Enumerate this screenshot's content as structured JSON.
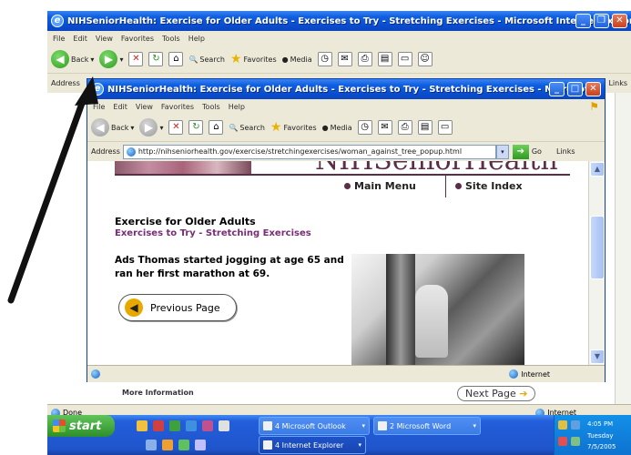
{
  "back_window": {
    "title": "NIHSeniorHealth: Exercise for Older Adults - Exercises to Try - Stretching Exercises - Microsoft Internet Explorer",
    "menu": [
      "File",
      "Edit",
      "View",
      "Favorites",
      "Tools",
      "Help"
    ],
    "toolbar": {
      "back": "Back",
      "search": "Search",
      "favorites": "Favorites",
      "media": "Media"
    },
    "address_label": "Address",
    "links_label": "Links",
    "status_left": "Done",
    "status_right": "Internet",
    "more_info": "More Information",
    "next_page": "Next Page"
  },
  "front_window": {
    "title": "NIHSeniorHealth: Exercise for Older Adults - Exercises to Try - Stretching Exercises - Microsof...",
    "menu": [
      "File",
      "Edit",
      "View",
      "Favorites",
      "Tools",
      "Help"
    ],
    "toolbar": {
      "back": "Back",
      "search": "Search",
      "favorites": "Favorites",
      "media": "Media"
    },
    "address_label": "Address",
    "url": "http://nihseniorhealth.gov/exercise/stretchingexercises/woman_against_tree_popup.html",
    "go_label": "Go",
    "links_label": "Links",
    "status_right": "Internet"
  },
  "page": {
    "logo": "NIHSeniorHealth",
    "nav_main_menu": "Main Menu",
    "nav_site_index": "Site Index",
    "heading": "Exercise for Older Adults",
    "subheading": "Exercises to Try - Stretching Exercises",
    "body": "Ads Thomas started jogging at age 65 and ran her first marathon at 69.",
    "prev_button": "Previous Page"
  },
  "taskbar": {
    "start": "start",
    "tasks": [
      {
        "label": "4 Microsoft Outlook"
      },
      {
        "label": "2 Microsoft Word"
      },
      {
        "label": "4 Internet Explorer"
      }
    ],
    "clock_time": "4:05 PM",
    "clock_day": "Tuesday",
    "clock_date": "7/5/2005"
  },
  "colors": {
    "title_blue": "#0a4ed0",
    "site_purple": "#5b2d47",
    "subheading_purple": "#7a2b78",
    "taskbar_blue": "#245edb",
    "start_green": "#2e8f2a"
  }
}
